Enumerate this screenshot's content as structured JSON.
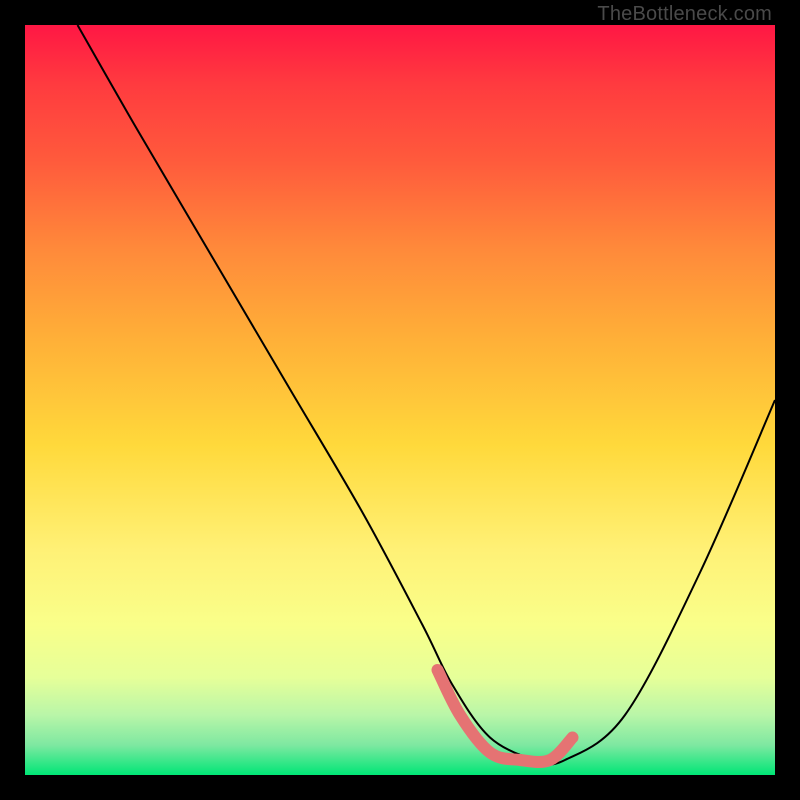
{
  "attribution": "TheBottleneck.com",
  "chart_data": {
    "type": "line",
    "title": "",
    "xlabel": "",
    "ylabel": "",
    "xlim": [
      0,
      100
    ],
    "ylim": [
      0,
      100
    ],
    "series": [
      {
        "name": "bottleneck-curve",
        "x": [
          7,
          15,
          25,
          35,
          45,
          53,
          57,
          62,
          68,
          72,
          80,
          90,
          100
        ],
        "y": [
          100,
          86,
          69,
          52,
          35,
          20,
          12,
          5,
          2,
          2,
          8,
          27,
          50
        ],
        "stroke": "#000000",
        "stroke_width": 2
      },
      {
        "name": "optimal-range-highlight",
        "x": [
          55,
          58,
          62,
          66,
          70,
          73
        ],
        "y": [
          14,
          8,
          3,
          2,
          2,
          5
        ],
        "stroke": "#e57373",
        "stroke_width": 12
      }
    ],
    "background": {
      "type": "vertical-gradient",
      "stops": [
        {
          "pos": 0.0,
          "color": "#ff1744"
        },
        {
          "pos": 0.3,
          "color": "#ff8a3a"
        },
        {
          "pos": 0.56,
          "color": "#ffd93b"
        },
        {
          "pos": 0.8,
          "color": "#f9ff8a"
        },
        {
          "pos": 1.0,
          "color": "#00e676"
        }
      ]
    }
  }
}
